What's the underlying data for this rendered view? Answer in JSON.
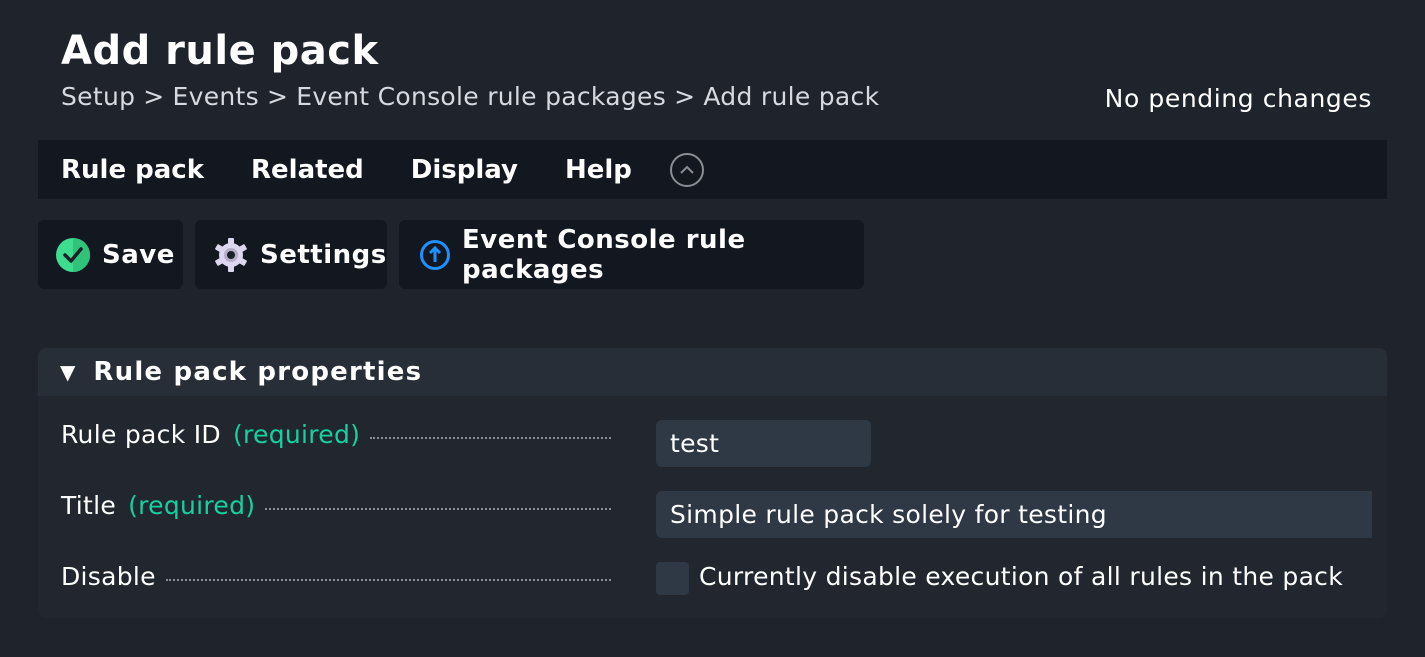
{
  "header": {
    "title": "Add rule pack",
    "breadcrumb": [
      "Setup",
      "Events",
      "Event Console rule packages",
      "Add rule pack"
    ],
    "breadcrumb_separator": ">",
    "pending_changes": "No pending changes"
  },
  "menubar": {
    "items": [
      "Rule pack",
      "Related",
      "Display",
      "Help"
    ],
    "collapse_icon": "chevron-up-circle-icon"
  },
  "toolbar": {
    "save_label": "Save",
    "save_icon": "check-circle-icon",
    "settings_label": "Settings",
    "settings_icon": "gear-icon",
    "ec_label": "Event Console rule packages",
    "ec_icon": "arrow-up-circle-icon"
  },
  "panel": {
    "title": "Rule pack properties",
    "required_text": "(required)",
    "fields": {
      "id": {
        "label": "Rule pack ID",
        "value": "test"
      },
      "title": {
        "label": "Title",
        "value": "Simple rule pack solely for testing"
      },
      "disable": {
        "label": "Disable",
        "checkbox_label": "Currently disable execution of all rules in the pack",
        "checked": false
      }
    }
  },
  "colors": {
    "background": "#1f232b",
    "menubar": "#131820",
    "required": "#15d1a0",
    "save_icon": "#3ddc8e",
    "link_icon": "#1e90ff"
  }
}
